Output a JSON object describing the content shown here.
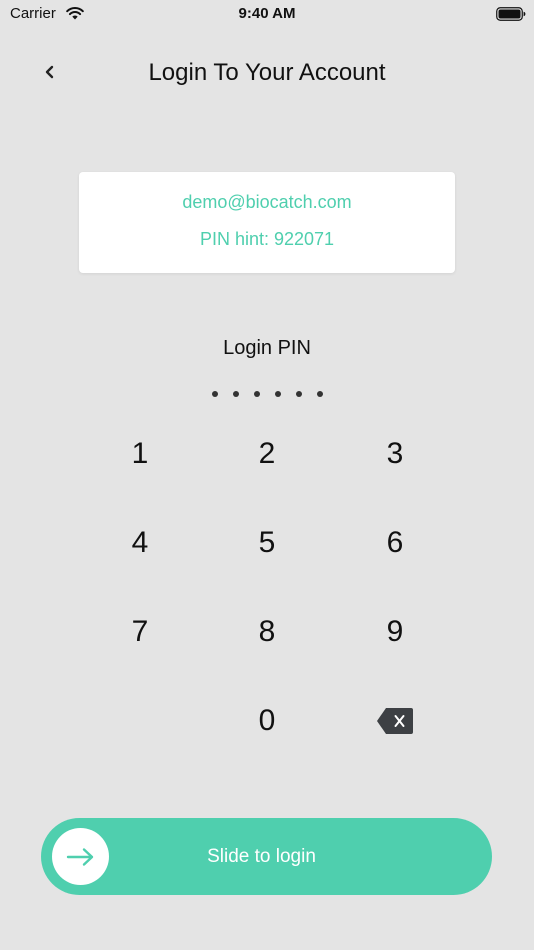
{
  "status_bar": {
    "carrier": "Carrier",
    "time": "9:40 AM",
    "wifi_icon": "wifi-icon",
    "battery_icon": "battery-icon"
  },
  "header": {
    "title": "Login To Your Account",
    "back_icon": "chevron-left-icon"
  },
  "info_card": {
    "email": "demo@biocatch.com",
    "pin_hint": "PIN hint: 922071"
  },
  "pin": {
    "label": "Login PIN",
    "dot_count": 6
  },
  "keypad": {
    "keys": [
      "1",
      "2",
      "3",
      "4",
      "5",
      "6",
      "7",
      "8",
      "9",
      "0"
    ],
    "delete_icon": "backspace-icon"
  },
  "slider": {
    "label": "Slide to login",
    "knob_icon": "arrow-right-icon"
  },
  "colors": {
    "accent": "#4fcfae",
    "background": "#e4e4e4",
    "card": "#ffffff"
  }
}
